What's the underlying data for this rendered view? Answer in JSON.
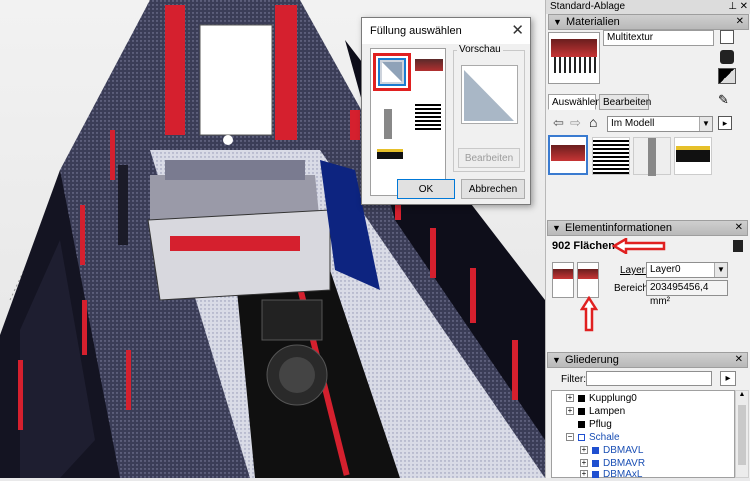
{
  "dialog": {
    "title": "Füllung auswählen",
    "preview_label": "Vorschau",
    "edit_button": "Bearbeiten",
    "ok_button": "OK",
    "cancel_button": "Abbrechen"
  },
  "tray": {
    "title": "Standard-Ablage",
    "materials": {
      "header": "Materialien",
      "material_name": "Multitextur",
      "tabs": [
        "Auswählen",
        "Bearbeiten"
      ],
      "library": "Im Modell"
    },
    "entity_info": {
      "header": "Elementinformationen",
      "faces": "902 Flächen",
      "layer_label": "Layer:",
      "layer_value": "Layer0",
      "area_label": "Bereich:",
      "area_value": "203495456,4 mm²"
    },
    "outliner": {
      "header": "Gliederung",
      "filter_label": "Filter:",
      "items": [
        {
          "label": "Kupplung0",
          "level": 0,
          "expand": "+",
          "color": "black"
        },
        {
          "label": "Lampen",
          "level": 0,
          "expand": "+",
          "color": "black"
        },
        {
          "label": "Pflug",
          "level": 0,
          "expand": "",
          "color": "black"
        },
        {
          "label": "Schale",
          "level": 0,
          "expand": "-",
          "color": "blue"
        },
        {
          "label": "DBMAVL",
          "level": 1,
          "expand": "+",
          "color": "blue"
        },
        {
          "label": "DBMAVR",
          "level": 1,
          "expand": "+",
          "color": "blue"
        },
        {
          "label": "DBMAxL",
          "level": 1,
          "expand": "+",
          "color": "blue"
        }
      ]
    }
  },
  "colors": {
    "accent_red": "#d5202e",
    "annotation_red": "#e02020",
    "selection_blue": "#0078d7"
  }
}
